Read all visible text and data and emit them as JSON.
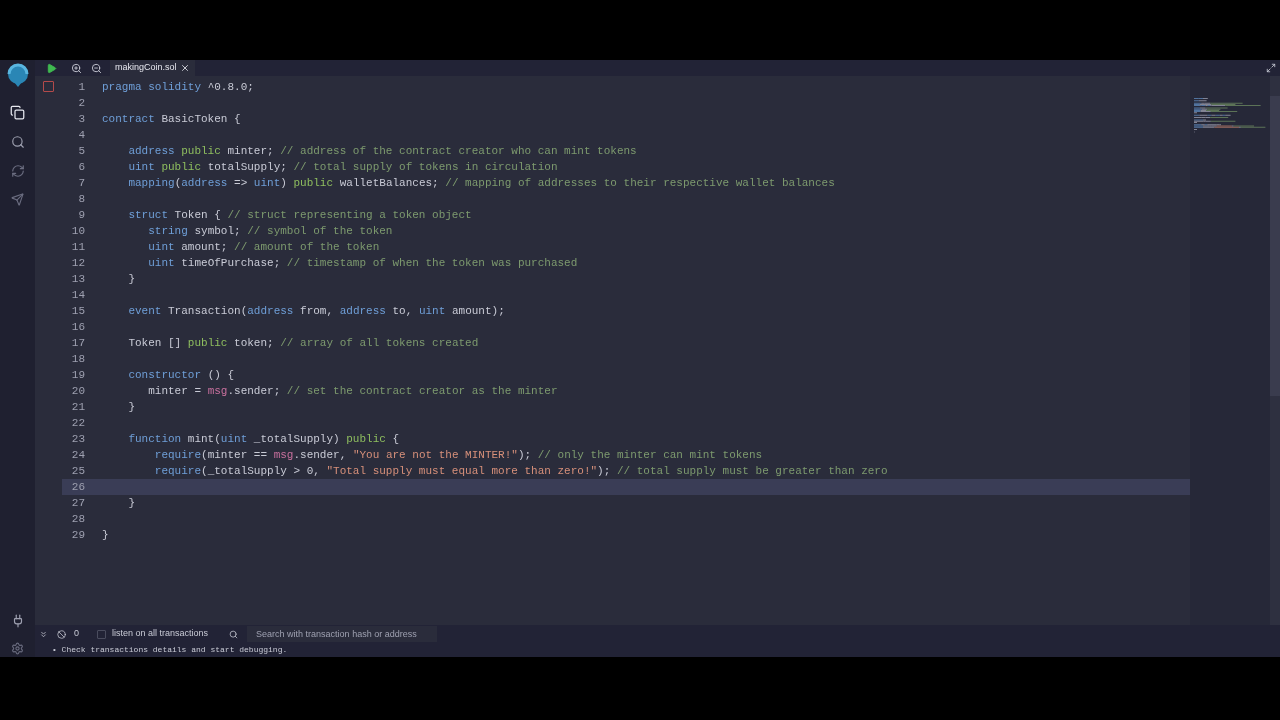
{
  "toolbar": {
    "tab": {
      "label": "makingCoin.sol",
      "selected": true
    }
  },
  "editor": {
    "lines": [
      {
        "number": "1",
        "current": false,
        "tokens": [
          {
            "kind": "keyword",
            "text": "pragma "
          },
          {
            "kind": "keyword",
            "text": "solidity"
          },
          {
            "kind": "plain",
            "text": " ^0.8.0;"
          }
        ]
      },
      {
        "number": "2",
        "current": false
      },
      {
        "number": "3",
        "current": false,
        "tokens": [
          {
            "kind": "keyword",
            "text": "contract"
          },
          {
            "kind": "plain",
            "text": " BasicToken {"
          }
        ]
      },
      {
        "number": "4",
        "current": false
      },
      {
        "number": "5",
        "current": false,
        "tokens": [
          {
            "kind": "keyword",
            "text": "    address "
          },
          {
            "kind": "visibility",
            "text": "public"
          },
          {
            "kind": "plain",
            "text": " minter; "
          },
          {
            "kind": "comment",
            "text": "// address of the contract creator who can mint tokens"
          }
        ]
      },
      {
        "number": "6",
        "current": false,
        "tokens": [
          {
            "kind": "keyword",
            "text": "    uint "
          },
          {
            "kind": "visibility",
            "text": "public"
          },
          {
            "kind": "plain",
            "text": " totalSupply; "
          },
          {
            "kind": "comment",
            "text": "// total supply of tokens in circulation"
          }
        ]
      },
      {
        "number": "7",
        "current": false,
        "tokens": [
          {
            "kind": "keyword",
            "text": "    mapping"
          },
          {
            "kind": "plain",
            "text": "("
          },
          {
            "kind": "keyword",
            "text": "address"
          },
          {
            "kind": "plain",
            "text": " => "
          },
          {
            "kind": "keyword",
            "text": "uint"
          },
          {
            "kind": "plain",
            "text": ") "
          },
          {
            "kind": "visibility",
            "text": "public"
          },
          {
            "kind": "plain",
            "text": " walletBalances; "
          },
          {
            "kind": "comment",
            "text": "// mapping of addresses to their respective wallet balances"
          }
        ]
      },
      {
        "number": "8",
        "current": false
      },
      {
        "number": "9",
        "current": false,
        "tokens": [
          {
            "kind": "keyword",
            "text": "    struct"
          },
          {
            "kind": "plain",
            "text": " Token { "
          },
          {
            "kind": "comment",
            "text": "// struct representing a token object"
          }
        ]
      },
      {
        "number": "10",
        "current": false,
        "tokens": [
          {
            "kind": "keyword",
            "text": "       string"
          },
          {
            "kind": "plain",
            "text": " symbol; "
          },
          {
            "kind": "comment",
            "text": "// symbol of the token"
          }
        ]
      },
      {
        "number": "11",
        "current": false,
        "tokens": [
          {
            "kind": "keyword",
            "text": "       uint"
          },
          {
            "kind": "plain",
            "text": " amount; "
          },
          {
            "kind": "comment",
            "text": "// amount of the token"
          }
        ]
      },
      {
        "number": "12",
        "current": false,
        "tokens": [
          {
            "kind": "keyword",
            "text": "       uint"
          },
          {
            "kind": "plain",
            "text": " timeOfPurchase; "
          },
          {
            "kind": "comment",
            "text": "// timestamp of when the token was purchased"
          }
        ]
      },
      {
        "number": "13",
        "current": false,
        "tokens": [
          {
            "kind": "plain",
            "text": "    }"
          }
        ]
      },
      {
        "number": "14",
        "current": false
      },
      {
        "number": "15",
        "current": false,
        "tokens": [
          {
            "kind": "keyword",
            "text": "    event"
          },
          {
            "kind": "plain",
            "text": " Transaction("
          },
          {
            "kind": "keyword",
            "text": "address"
          },
          {
            "kind": "plain",
            "text": " from, "
          },
          {
            "kind": "keyword",
            "text": "address"
          },
          {
            "kind": "plain",
            "text": " to, "
          },
          {
            "kind": "keyword",
            "text": "uint"
          },
          {
            "kind": "plain",
            "text": " amount);"
          }
        ]
      },
      {
        "number": "16",
        "current": false
      },
      {
        "number": "17",
        "current": false,
        "tokens": [
          {
            "kind": "plain",
            "text": "    Token [] "
          },
          {
            "kind": "visibility",
            "text": "public"
          },
          {
            "kind": "plain",
            "text": " token; "
          },
          {
            "kind": "comment",
            "text": "// array of all tokens created"
          }
        ]
      },
      {
        "number": "18",
        "current": false
      },
      {
        "number": "19",
        "current": false,
        "tokens": [
          {
            "kind": "keyword",
            "text": "    constructor"
          },
          {
            "kind": "plain",
            "text": " () {"
          }
        ]
      },
      {
        "number": "20",
        "current": false,
        "tokens": [
          {
            "kind": "plain",
            "text": "       minter = "
          },
          {
            "kind": "builtin",
            "text": "msg"
          },
          {
            "kind": "plain",
            "text": ".sender; "
          },
          {
            "kind": "comment",
            "text": "// set the contract creator as the minter"
          }
        ]
      },
      {
        "number": "21",
        "current": false,
        "tokens": [
          {
            "kind": "plain",
            "text": "    }"
          }
        ]
      },
      {
        "number": "22",
        "current": false
      },
      {
        "number": "23",
        "current": false,
        "tokens": [
          {
            "kind": "keyword",
            "text": "    function"
          },
          {
            "kind": "plain",
            "text": " mint("
          },
          {
            "kind": "keyword",
            "text": "uint"
          },
          {
            "kind": "plain",
            "text": " _totalSupply) "
          },
          {
            "kind": "visibility",
            "text": "public"
          },
          {
            "kind": "plain",
            "text": " {"
          }
        ]
      },
      {
        "number": "24",
        "current": false,
        "tokens": [
          {
            "kind": "keyword",
            "text": "        require"
          },
          {
            "kind": "plain",
            "text": "(minter == "
          },
          {
            "kind": "builtin",
            "text": "msg"
          },
          {
            "kind": "plain",
            "text": ".sender, "
          },
          {
            "kind": "string",
            "text": "\"You are not the MINTER!\""
          },
          {
            "kind": "plain",
            "text": "); "
          },
          {
            "kind": "comment",
            "text": "// only the minter can mint tokens"
          }
        ]
      },
      {
        "number": "25",
        "current": false,
        "tokens": [
          {
            "kind": "keyword",
            "text": "        require"
          },
          {
            "kind": "plain",
            "text": "(_totalSupply > 0, "
          },
          {
            "kind": "string",
            "text": "\"Total supply must equal more than zero!\""
          },
          {
            "kind": "plain",
            "text": "); "
          },
          {
            "kind": "comment",
            "text": "// total supply must be greater than zero"
          }
        ]
      },
      {
        "number": "26",
        "current": true
      },
      {
        "number": "27",
        "current": false,
        "tokens": [
          {
            "kind": "plain",
            "text": "    }"
          }
        ]
      },
      {
        "number": "28",
        "current": false
      },
      {
        "number": "29",
        "current": false,
        "tokens": [
          {
            "kind": "plain",
            "text": "}"
          }
        ]
      }
    ]
  },
  "terminal": {
    "count": "0",
    "listen": {
      "label": "listen on all transactions",
      "checked": false
    },
    "search": {
      "placeholder": "Search with transaction hash or address"
    },
    "log": "• Check transactions details and start debugging."
  }
}
